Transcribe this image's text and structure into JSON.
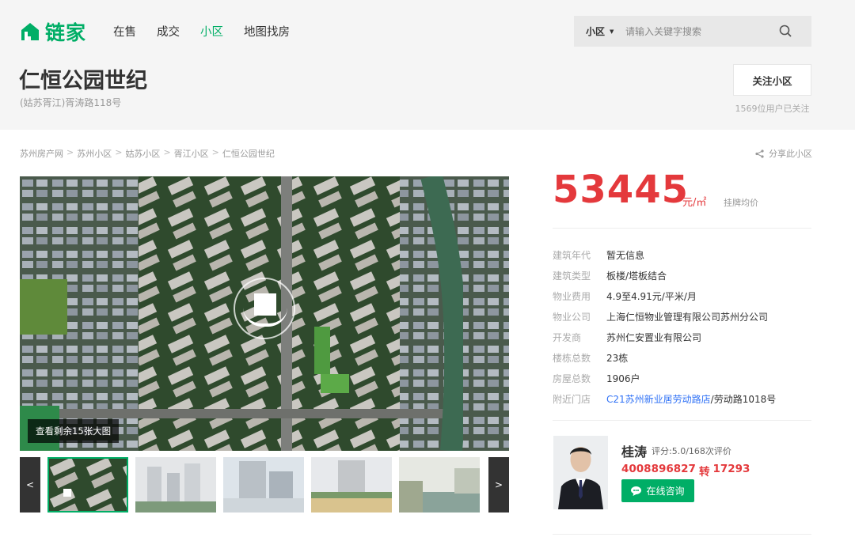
{
  "header": {
    "logo_text": "链家",
    "nav": [
      {
        "label": "在售"
      },
      {
        "label": "成交"
      },
      {
        "label": "小区",
        "active": true
      },
      {
        "label": "地图找房"
      }
    ],
    "search": {
      "type_label": "小区",
      "placeholder": "请输入关键字搜索"
    }
  },
  "community": {
    "title": "仁恒公园世纪",
    "address": "(姑苏胥江)胥涛路118号",
    "follow_label": "关注小区",
    "follow_count": "1569位用户已关注"
  },
  "breadcrumb": [
    "苏州房产网",
    "苏州小区",
    "姑苏小区",
    "胥江小区",
    "仁恒公园世纪"
  ],
  "share_label": "分享此小区",
  "gallery": {
    "more_label": "查看剩余15张大图",
    "prev": "<",
    "next": ">"
  },
  "price": {
    "value": "53445",
    "unit": "元/㎡",
    "label": "挂牌均价"
  },
  "info": [
    {
      "k": "建筑年代",
      "v": "暂无信息"
    },
    {
      "k": "建筑类型",
      "v": "板楼/塔板结合"
    },
    {
      "k": "物业费用",
      "v": "4.9至4.91元/平米/月"
    },
    {
      "k": "物业公司",
      "v": "上海仁恒物业管理有限公司苏州分公司"
    },
    {
      "k": "开发商",
      "v": "苏州仁安置业有限公司"
    },
    {
      "k": "楼栋总数",
      "v": "23栋"
    },
    {
      "k": "房屋总数",
      "v": "1906户"
    },
    {
      "k": "附近门店",
      "link": "C21苏州新业居劳动路店",
      "v": "/劳动路1018号"
    }
  ],
  "agent": {
    "name": "桂涛",
    "score": "评分:5.0/168次评价",
    "phone": "4008896827",
    "ext_sep": "转",
    "ext": "17293",
    "chat_label": "在线咨询"
  },
  "colors": {
    "brand": "#00ae66",
    "price": "#e4393c",
    "link": "#3072f6"
  }
}
